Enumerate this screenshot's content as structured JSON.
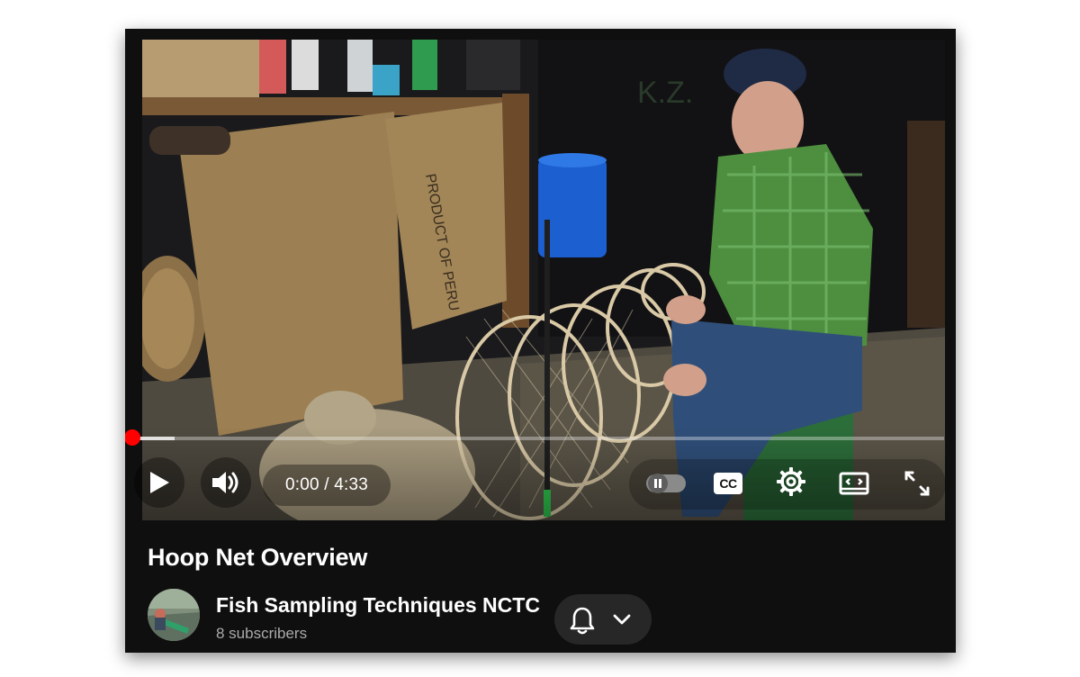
{
  "video": {
    "current_time": "0:00",
    "duration": "4:33",
    "time_display": "0:00 / 4:33",
    "progress_fraction": 0,
    "buffered_fraction": 0.06,
    "scene_text": {
      "sack_print": "PRODUCT OF PERU",
      "wall_letters": "K.Z."
    }
  },
  "controls": {
    "play": "play-icon",
    "volume": "volume-icon",
    "autoplay": "autoplay-toggle-icon",
    "captions_label": "CC",
    "settings": "gear-icon",
    "theater": "theater-mode-icon",
    "fullscreen": "fullscreen-icon"
  },
  "video_title": "Hoop Net Overview",
  "channel": {
    "name": "Fish Sampling Techniques NCTC",
    "subscribers": "8 subscribers"
  },
  "subscribe": {
    "bell": "bell-icon",
    "chevron": "chevron-down-icon"
  },
  "colors": {
    "accent": "#ff0000",
    "card_bg": "#0f0f0f",
    "pill_bg": "#272727",
    "secondary_text": "#aaaaaa"
  }
}
